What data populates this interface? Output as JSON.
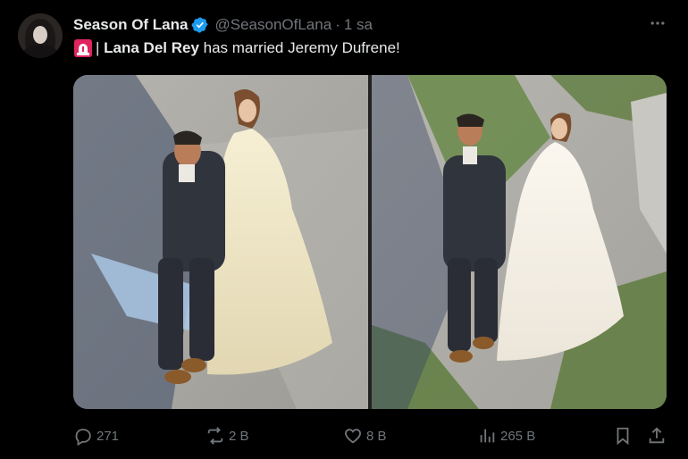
{
  "tweet": {
    "display_name": "Season Of Lana",
    "handle": "@SeasonOfLana",
    "separator": "·",
    "time": "1 sa",
    "text_prefix": "| ",
    "text_bold": "Lana Del Rey",
    "text_rest": " has married Jeremy Dufrene!",
    "emoji": "siren-icon"
  },
  "metrics": {
    "replies": "271",
    "reposts": "2 B",
    "likes": "8 B",
    "views": "265 B"
  },
  "colors": {
    "background": "#000000",
    "text": "#e7e9ea",
    "muted": "#71767b",
    "verified": "#1d9bf0"
  }
}
